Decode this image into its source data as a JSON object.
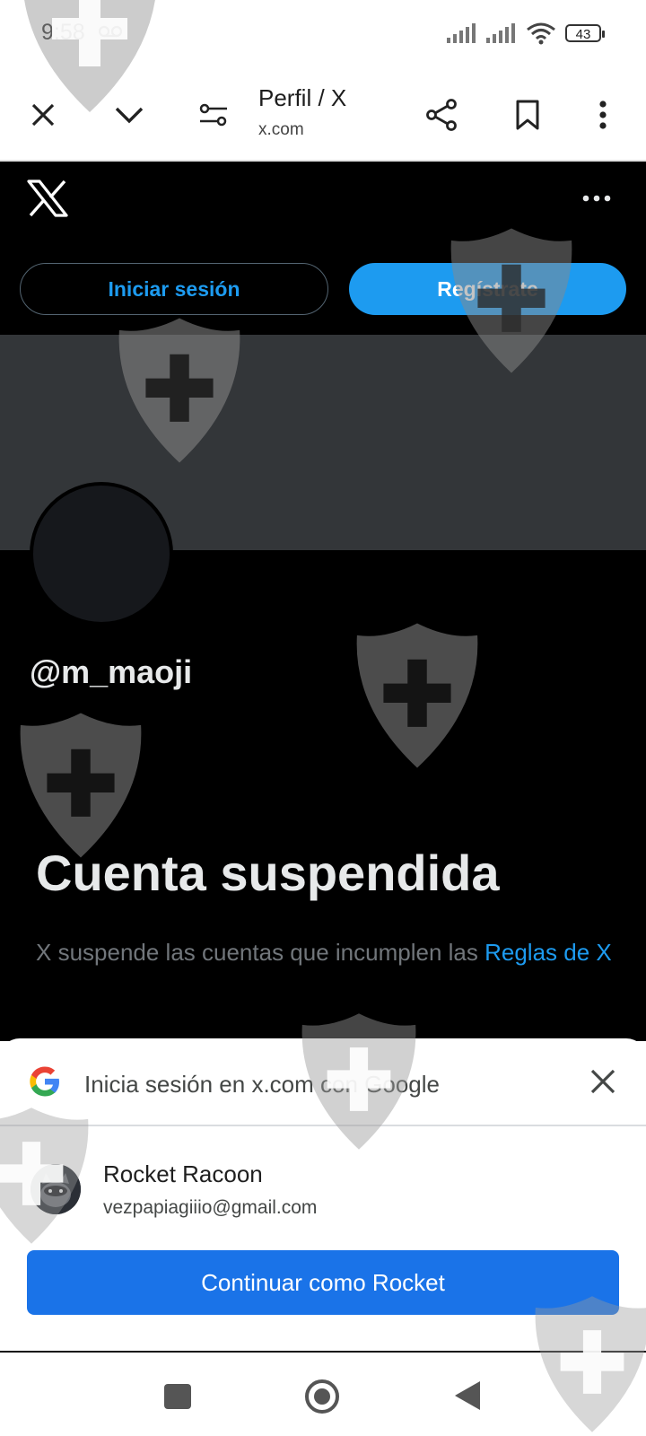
{
  "status_bar": {
    "time": "9:58",
    "battery": "43",
    "icons": [
      "voicemail-icon",
      "signal-icon",
      "signal-icon",
      "wifi-icon",
      "battery-icon"
    ]
  },
  "browser": {
    "page_title": "Perfil / X",
    "url": "x.com",
    "icons": [
      "close-icon",
      "chevron-down-icon",
      "page-settings-icon",
      "share-icon",
      "bookmark-icon",
      "more-vert-icon"
    ]
  },
  "x_page": {
    "login_label": "Iniciar sesión",
    "signup_label": "Regístrate",
    "handle": "@m_maoji",
    "suspended_title": "Cuenta suspendida",
    "suspended_text": "X suspende las cuentas que incumplen las ",
    "rules_link": "Reglas de X"
  },
  "google_signin": {
    "title": "Inicia sesión en x.com con Google",
    "account_name": "Rocket Racoon",
    "account_email": "vezpapiagiiio@gmail.com",
    "continue_label": "Continuar como Rocket"
  },
  "colors": {
    "x_blue": "#1d9bf0",
    "google_blue": "#1a73e8",
    "page_bg": "#000000"
  }
}
